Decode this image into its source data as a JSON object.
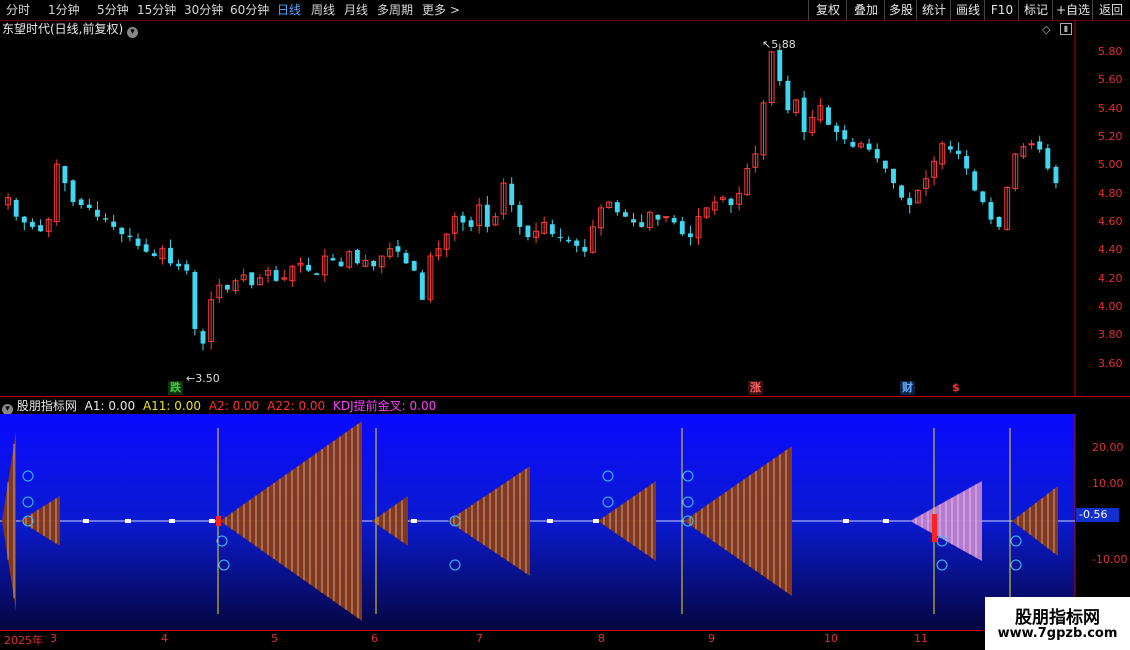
{
  "toolbar": {
    "periods": [
      "分时",
      "1分钟",
      "5分钟",
      "15分钟",
      "30分钟",
      "60分钟",
      "日线",
      "周线",
      "月线",
      "多周期",
      "更多 >"
    ],
    "active_period": "日线",
    "actions": [
      "复权",
      "叠加",
      "多股",
      "统计",
      "画线",
      "F10",
      "标记",
      "+自选",
      "返回"
    ]
  },
  "main_chart": {
    "title": "东望时代(日线,前复权)",
    "high_label": "5.88",
    "low_label": "3.50",
    "y_ticks": [
      "5.80",
      "5.60",
      "5.40",
      "5.20",
      "5.00",
      "4.80",
      "4.60",
      "4.40",
      "4.20",
      "4.00",
      "3.80",
      "3.60"
    ],
    "markers": [
      {
        "text": "跌",
        "color": "#3cd03c",
        "bg": "#1a3a1a"
      },
      {
        "text": "涨",
        "color": "#ff6060",
        "bg": "#3a1010"
      },
      {
        "text": "财",
        "color": "#60b0ff",
        "bg": "#102040"
      },
      {
        "text": "$",
        "color": "#ff3030",
        "bg": "#000"
      }
    ]
  },
  "indicator": {
    "name": "股朋指标网",
    "fields": [
      {
        "label": "A1:",
        "value": "0.00",
        "color": "#e8e8e8"
      },
      {
        "label": "A11:",
        "value": "0.00",
        "color": "#e8e020"
      },
      {
        "label": "A2:",
        "value": "0.00",
        "color": "#ff3030"
      },
      {
        "label": "A22:",
        "value": "0.00",
        "color": "#ff3030"
      },
      {
        "label": "KDJ提前金叉:",
        "value": "0.00",
        "color": "#ff40ff"
      }
    ],
    "y_ticks": [
      "20.00",
      "10.00",
      "-10.00"
    ],
    "current_value": "-0.56"
  },
  "x_axis": {
    "labels": [
      "2025年",
      "3",
      "4",
      "5",
      "6",
      "7",
      "8",
      "9",
      "10",
      "11"
    ]
  },
  "watermark": {
    "line1": "股朋指标网",
    "line2": "www.7gpzb.com"
  },
  "colors": {
    "up": "#ff3b3b",
    "down": "#3fd8f0",
    "axis": "#c00000"
  },
  "chart_data": {
    "type": "candlestick",
    "title": "东望时代(日线,前复权)",
    "ylim": [
      3.5,
      5.9
    ],
    "y_ticks": [
      3.6,
      3.8,
      4.0,
      4.2,
      4.4,
      4.6,
      4.8,
      5.0,
      5.2,
      5.4,
      5.6,
      5.8
    ],
    "x_months": [
      "3",
      "4",
      "5",
      "6",
      "7",
      "8",
      "9",
      "10",
      "11"
    ],
    "high": 5.88,
    "low": 3.5,
    "close_series": [
      4.75,
      4.62,
      4.58,
      4.55,
      4.52,
      4.6,
      4.98,
      4.85,
      4.72,
      4.7,
      4.68,
      4.62,
      4.6,
      4.55,
      4.5,
      4.48,
      4.42,
      4.38,
      4.35,
      4.4,
      4.3,
      4.28,
      4.25,
      3.85,
      3.75,
      4.05,
      4.15,
      4.12,
      4.18,
      4.22,
      4.15,
      4.2,
      4.25,
      4.18,
      4.2,
      4.28,
      4.3,
      4.25,
      4.22,
      4.35,
      4.32,
      4.28,
      4.38,
      4.3,
      4.32,
      4.28,
      4.35,
      4.4,
      4.38,
      4.3,
      4.25,
      4.05,
      4.35,
      4.4,
      4.5,
      4.62,
      4.58,
      4.55,
      4.7,
      4.55,
      4.62,
      4.85,
      4.7,
      4.55,
      4.48,
      4.52,
      4.58,
      4.5,
      4.48,
      4.45,
      4.42,
      4.38,
      4.55,
      4.68,
      4.72,
      4.65,
      4.62,
      4.58,
      4.55,
      4.65,
      4.6,
      4.62,
      4.58,
      4.5,
      4.48,
      4.62,
      4.68,
      4.72,
      4.75,
      4.7,
      4.78,
      4.95,
      5.05,
      5.4,
      5.75,
      5.55,
      5.35,
      5.42,
      5.2,
      5.3,
      5.38,
      5.25,
      5.2,
      5.15,
      5.1,
      5.12,
      5.08,
      5.02,
      4.95,
      4.85,
      4.75,
      4.7,
      4.8,
      4.88,
      5.0,
      5.12,
      5.08,
      5.05,
      4.95,
      4.8,
      4.72,
      4.6,
      4.55,
      4.82,
      5.05,
      5.1,
      5.12,
      5.08,
      4.95,
      4.85
    ]
  }
}
